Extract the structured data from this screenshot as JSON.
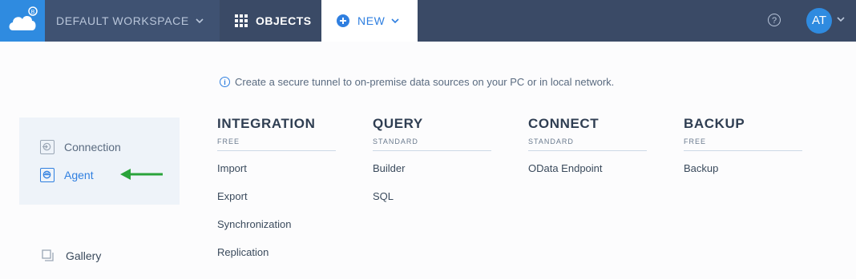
{
  "topbar": {
    "workspace_label": "DEFAULT WORKSPACE",
    "objects_label": "OBJECTS",
    "new_label": "NEW",
    "help_label": "?",
    "avatar_initials": "AT",
    "accent_color": "#2f8be0",
    "bar_color": "#3a4a66"
  },
  "info_text": "Create a secure tunnel to on-premise data sources on your PC or in local network.",
  "left_panel": {
    "items": [
      {
        "label": "Connection",
        "icon": "connection-icon"
      },
      {
        "label": "Agent",
        "icon": "agent-icon",
        "selected": true
      }
    ],
    "gallery_label": "Gallery"
  },
  "columns": [
    {
      "title": "INTEGRATION",
      "tier": "FREE",
      "items": [
        "Import",
        "Export",
        "Synchronization",
        "Replication"
      ]
    },
    {
      "title": "QUERY",
      "tier": "STANDARD",
      "items": [
        "Builder",
        "SQL"
      ]
    },
    {
      "title": "CONNECT",
      "tier": "STANDARD",
      "items": [
        "OData Endpoint"
      ]
    },
    {
      "title": "BACKUP",
      "tier": "FREE",
      "items": [
        "Backup"
      ]
    }
  ],
  "annotation": {
    "arrow_color": "#2aa33a",
    "points_to": "Agent"
  }
}
